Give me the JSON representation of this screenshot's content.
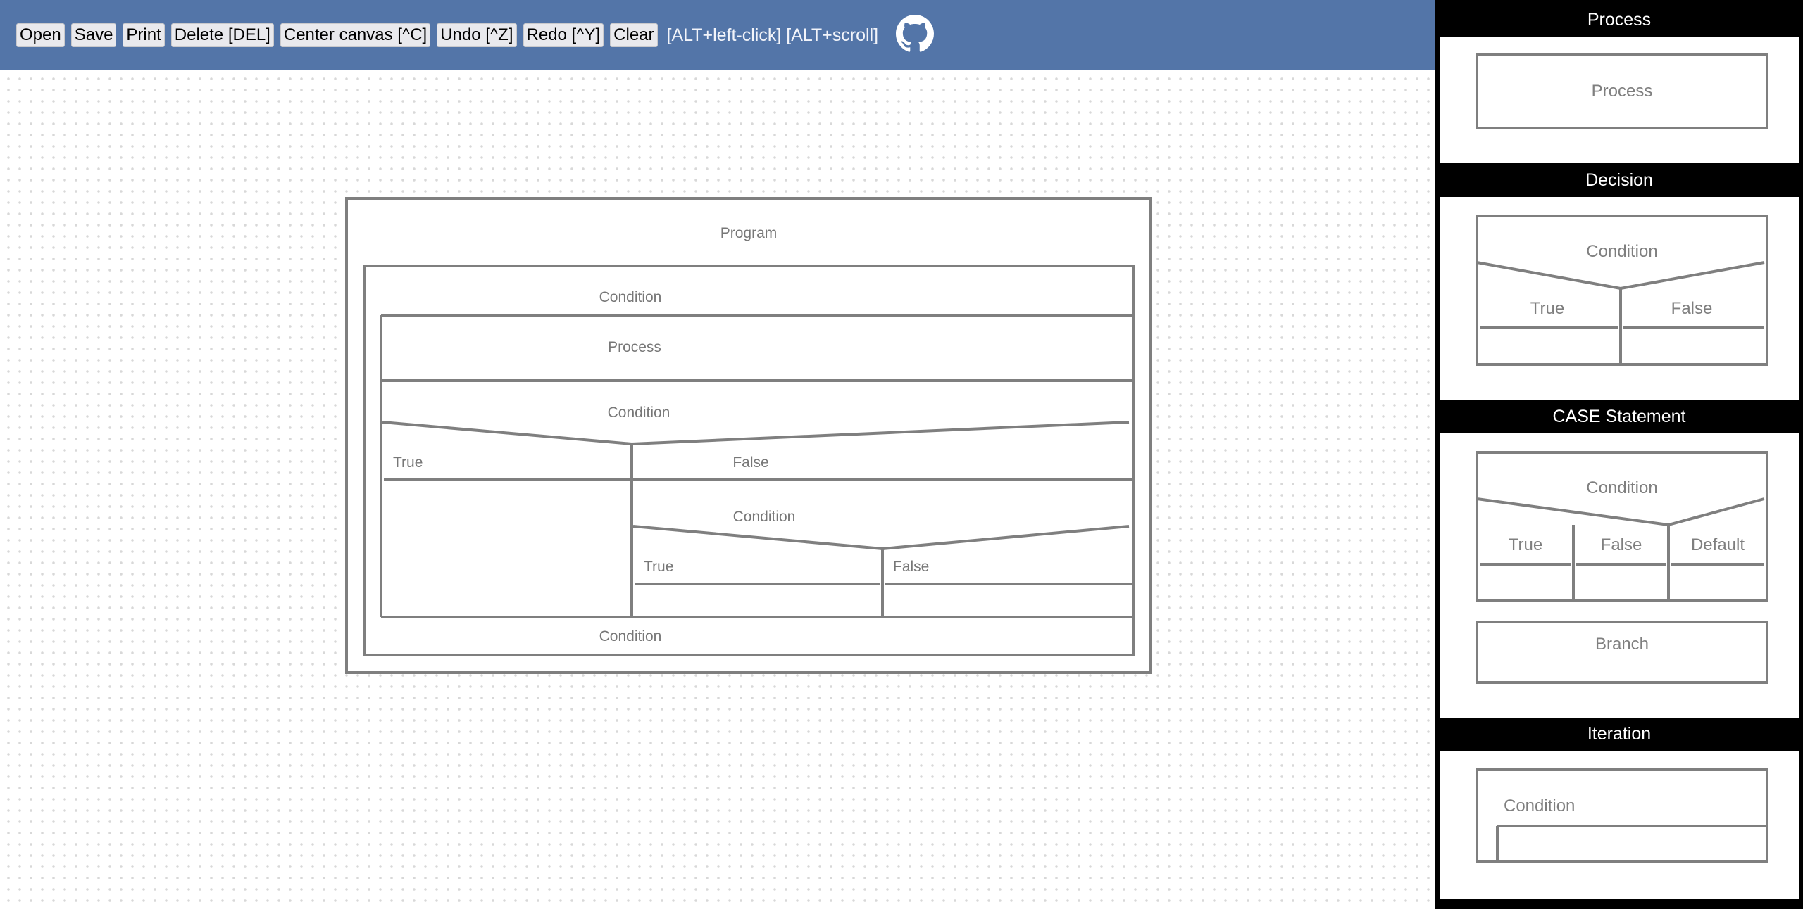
{
  "toolbar": {
    "open_label": "Open",
    "save_label": "Save",
    "print_label": "Print",
    "delete_label": "Delete [DEL]",
    "center_label": "Center canvas [^C]",
    "undo_label": "Undo [^Z]",
    "redo_label": "Redo [^Y]",
    "clear_label": "Clear",
    "hint_text": "[ALT+left-click] [ALT+scroll]",
    "github_icon": "github-icon",
    "background_color": "#5375a8"
  },
  "canvas": {
    "program_label": "Program",
    "outer_loop_condition": "Condition",
    "process_label": "Process",
    "decision_condition": "Condition",
    "decision_true": "True",
    "decision_false": "False",
    "nested_condition": "Condition",
    "nested_true": "True",
    "nested_false": "False",
    "bottom_condition": "Condition"
  },
  "palette": {
    "process": {
      "header": "Process",
      "label": "Process"
    },
    "decision": {
      "header": "Decision",
      "condition": "Condition",
      "true_label": "True",
      "false_label": "False"
    },
    "case": {
      "header": "CASE Statement",
      "condition": "Condition",
      "true_label": "True",
      "false_label": "False",
      "default_label": "Default",
      "branch_label": "Branch"
    },
    "iteration": {
      "header": "Iteration",
      "condition": "Condition"
    }
  }
}
